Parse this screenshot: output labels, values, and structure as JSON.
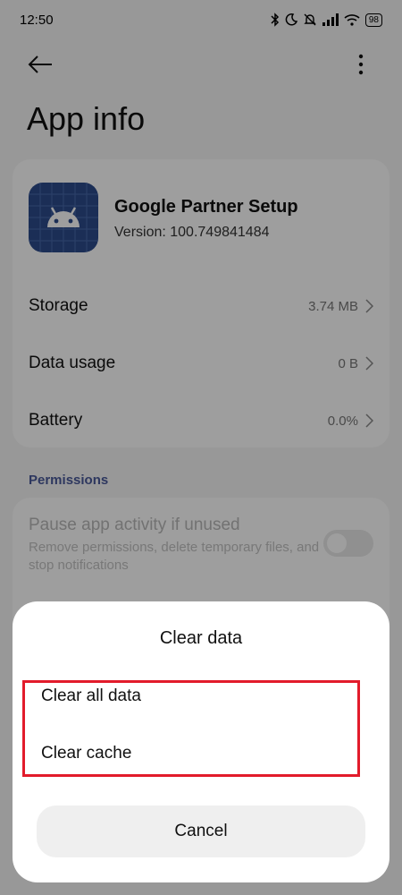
{
  "status_bar": {
    "time": "12:50",
    "battery": "98",
    "icons": [
      "bluetooth-icon",
      "moon-icon",
      "mute-icon",
      "signal-icon",
      "wifi-icon",
      "battery-icon"
    ]
  },
  "top_bar": {
    "back_icon": "arrow-left-icon",
    "menu_icon": "more-vertical-icon"
  },
  "page": {
    "title": "App info"
  },
  "app": {
    "name": "Google Partner Setup",
    "version": "Version: 100.749841484",
    "icon": "android-icon",
    "icon_color": "#2c4b8c"
  },
  "info_rows": [
    {
      "label": "Storage",
      "value": "3.74 MB"
    },
    {
      "label": "Data usage",
      "value": "0 B"
    },
    {
      "label": "Battery",
      "value": "0.0%"
    }
  ],
  "permissions": {
    "header": "Permissions",
    "pause_title": "Pause app activity if unused",
    "pause_desc": "Remove permissions, delete temporary files, and stop notifications",
    "toggle_on": false
  },
  "dialog": {
    "title": "Clear data",
    "options": [
      "Clear all data",
      "Clear cache"
    ],
    "cancel_label": "Cancel",
    "highlight_color": "#e21b2b"
  },
  "colors": {
    "section_header": "#4a5a9a",
    "background": "#f5f5f5"
  }
}
